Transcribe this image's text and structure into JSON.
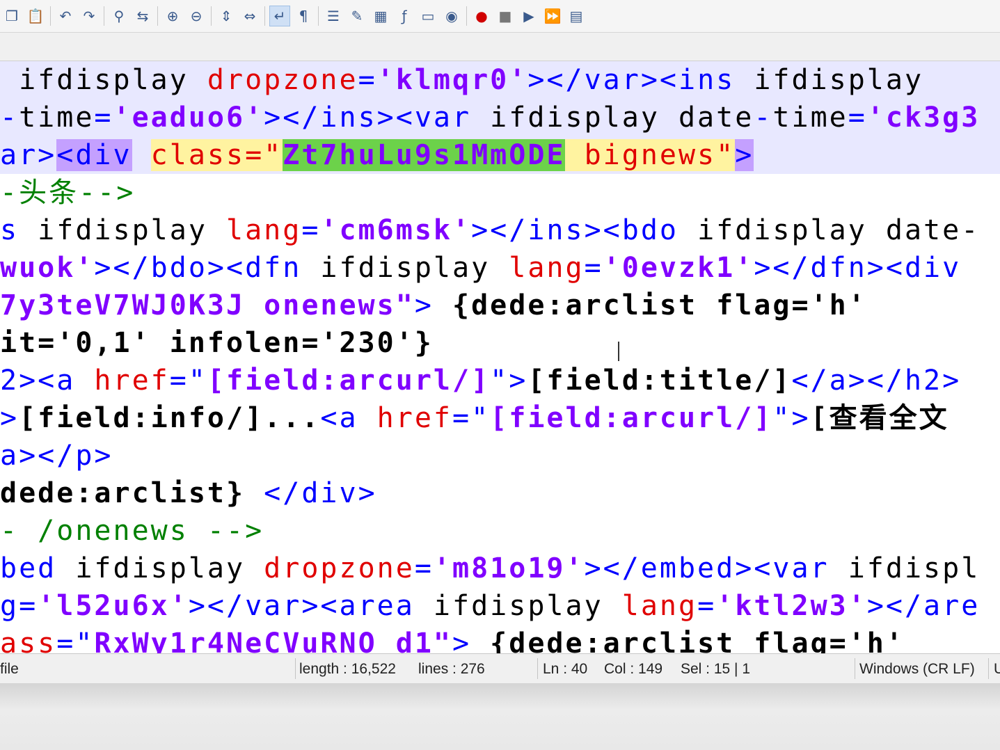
{
  "toolbar": {
    "icons": [
      "copy-icon",
      "paste-icon",
      "undo-icon",
      "redo-icon",
      "find-icon",
      "replace-icon",
      "zoom-in-icon",
      "zoom-out-icon",
      "sync-vertical-icon",
      "sync-horizontal-icon",
      "word-wrap-icon",
      "show-all-characters-icon",
      "indent-guide-icon",
      "user-defined-language-icon",
      "document-map-icon",
      "function-list-icon",
      "folder-as-workspace-icon",
      "monitoring-icon",
      "record-macro-icon",
      "stop-recording-icon",
      "playback-macro-icon",
      "run-macro-multiple-icon",
      "save-macro-icon"
    ]
  },
  "editor": {
    "lines": [
      [
        [
          "tag",
          " "
        ],
        [
          "txt",
          "ifdisplay "
        ],
        [
          "attr",
          "dropzone"
        ],
        [
          "tag",
          "="
        ],
        [
          "val",
          "'klmqr0'"
        ],
        [
          "tag",
          "></var><ins "
        ],
        [
          "txt",
          "ifdisplay"
        ]
      ],
      [
        [
          "tag",
          "-"
        ],
        [
          "txt",
          "time"
        ],
        [
          "tag",
          "="
        ],
        [
          "val",
          "'eaduo6'"
        ],
        [
          "tag",
          "></ins><var "
        ],
        [
          "txt",
          "ifdisplay date"
        ],
        [
          "tag",
          "-"
        ],
        [
          "txt",
          "time"
        ],
        [
          "tag",
          "="
        ],
        [
          "val",
          "'ck3g3"
        ]
      ],
      [
        [
          "tag",
          "ar>"
        ],
        [
          "mtag",
          "<div"
        ],
        [
          "tag",
          " "
        ],
        [
          "mattr",
          "class=\""
        ],
        [
          "msel",
          "Zt7huLu9s1MmODE"
        ],
        [
          "mattr",
          " bignews\""
        ],
        [
          "mtag",
          ">"
        ]
      ],
      [
        [
          "cmt",
          "-头条-->"
        ]
      ],
      [
        [
          "tag",
          "s "
        ],
        [
          "txt",
          "ifdisplay "
        ],
        [
          "attr",
          "lang"
        ],
        [
          "tag",
          "="
        ],
        [
          "val",
          "'cm6msk'"
        ],
        [
          "tag",
          "></ins><bdo "
        ],
        [
          "txt",
          "ifdisplay date-"
        ]
      ],
      [
        [
          "val",
          "wuok'"
        ],
        [
          "tag",
          "></bdo><dfn "
        ],
        [
          "txt",
          "ifdisplay "
        ],
        [
          "attr",
          "lang"
        ],
        [
          "tag",
          "="
        ],
        [
          "val",
          "'0evzk1'"
        ],
        [
          "tag",
          "></dfn><div"
        ]
      ],
      [
        [
          "val",
          "7y3teV7WJ0K3J onenews\""
        ],
        [
          "tag",
          ">"
        ],
        [
          "bold",
          " {dede:arclist flag='h'"
        ]
      ],
      [
        [
          "bold",
          "it='0,1' infolen='230'}"
        ]
      ],
      [
        [
          "tag",
          "2><a "
        ],
        [
          "attr",
          "href"
        ],
        [
          "tag",
          "=\""
        ],
        [
          "val",
          "[field:arcurl/]"
        ],
        [
          "tag",
          "\">"
        ],
        [
          "bold",
          "[field:title/]"
        ],
        [
          "tag",
          "</a></h2>"
        ]
      ],
      [
        [
          "tag",
          ">"
        ],
        [
          "bold",
          "[field:info/]..."
        ],
        [
          "tag",
          "<a "
        ],
        [
          "attr",
          "href"
        ],
        [
          "tag",
          "=\""
        ],
        [
          "val",
          "[field:arcurl/]"
        ],
        [
          "tag",
          "\">"
        ],
        [
          "bold",
          "[查看全文"
        ]
      ],
      [
        [
          "tag",
          "a></p>"
        ]
      ],
      [
        [
          "bold",
          "dede:arclist}"
        ],
        [
          "tag",
          " </div>"
        ]
      ],
      [
        [
          "cmt",
          "- /onenews -->"
        ]
      ],
      [
        [
          "tag",
          "bed "
        ],
        [
          "txt",
          "ifdisplay "
        ],
        [
          "attr",
          "dropzone"
        ],
        [
          "tag",
          "="
        ],
        [
          "val",
          "'m81o19'"
        ],
        [
          "tag",
          "></embed><var "
        ],
        [
          "txt",
          "ifdispl"
        ]
      ],
      [
        [
          "tag",
          "g="
        ],
        [
          "val",
          "'l52u6x'"
        ],
        [
          "tag",
          "></var><area "
        ],
        [
          "txt",
          "ifdisplay "
        ],
        [
          "attr",
          "lang"
        ],
        [
          "tag",
          "="
        ],
        [
          "val",
          "'ktl2w3'"
        ],
        [
          "tag",
          "></are"
        ]
      ],
      [
        [
          "attr",
          "ass"
        ],
        [
          "tag",
          "=\""
        ],
        [
          "val",
          "RxWy1r4NeCVuRNO d1\""
        ],
        [
          "tag",
          ">"
        ],
        [
          "bold",
          " {dede:arclist flag='h'"
        ]
      ]
    ]
  },
  "status": {
    "file_type": "file",
    "length": "length : 16,522",
    "lines": "lines : 276",
    "ln": "Ln : 40",
    "col": "Col : 149",
    "sel": "Sel : 15 | 1",
    "eol": "Windows (CR LF)",
    "encoding_partial": "U"
  }
}
